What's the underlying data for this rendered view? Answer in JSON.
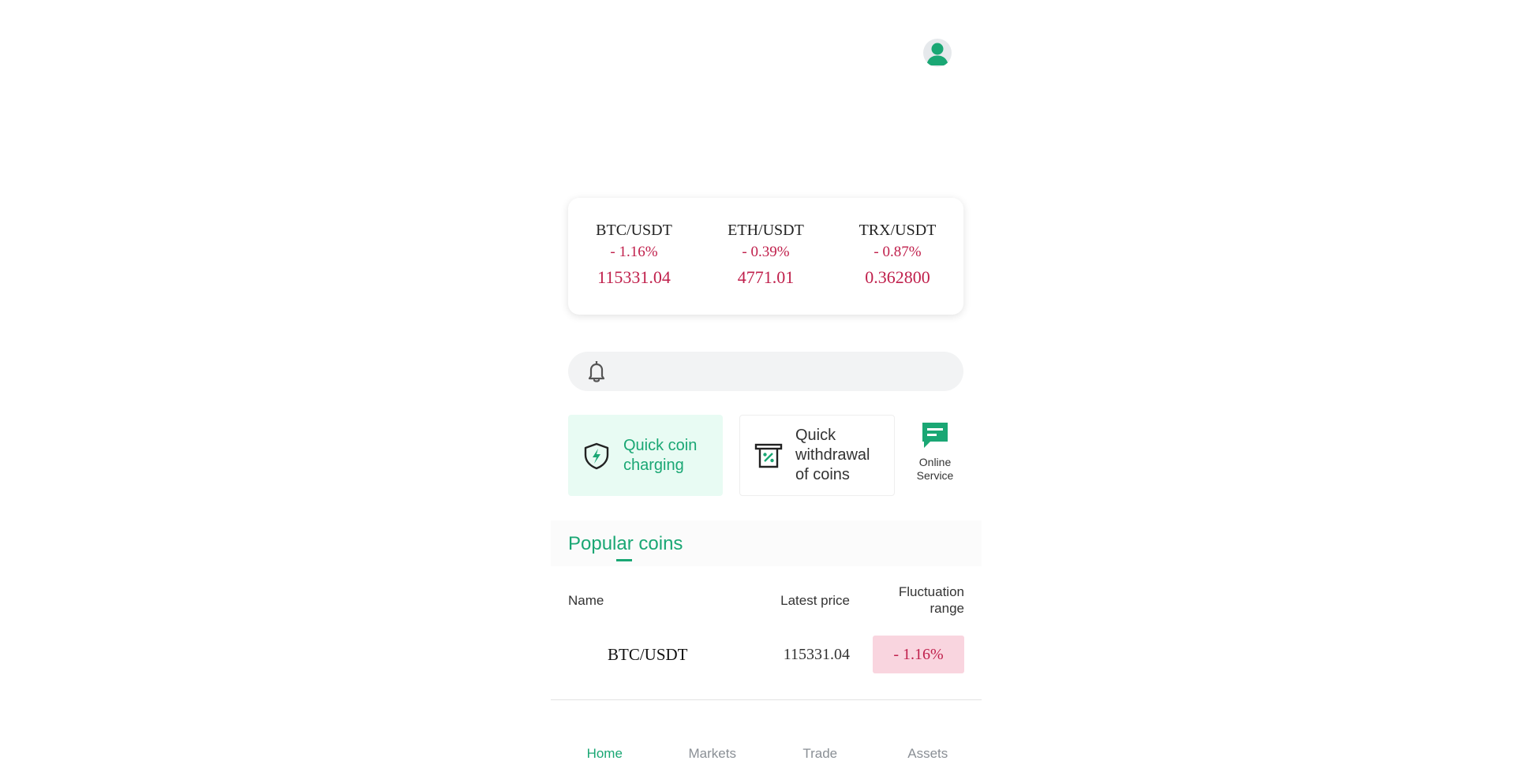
{
  "header": {
    "avatar_icon": "user-avatar-icon"
  },
  "tickers": [
    {
      "pair": "BTC/USDT",
      "change": "- 1.16%",
      "price": "115331.04"
    },
    {
      "pair": "ETH/USDT",
      "change": "- 0.39%",
      "price": "4771.01"
    },
    {
      "pair": "TRX/USDT",
      "change": "- 0.87%",
      "price": "0.362800"
    }
  ],
  "notice": {
    "icon": "bell-icon",
    "text": ""
  },
  "quick_actions": {
    "charge_label": "Quick coin charging",
    "withdraw_label": "Quick withdrawal of coins",
    "online_label": "Online Service"
  },
  "popular": {
    "tab_label": "Popular coins",
    "columns": {
      "name": "Name",
      "price": "Latest price",
      "range": "Fluctuation range"
    },
    "rows": [
      {
        "name": "BTC/USDT",
        "price": "115331.04",
        "change": "- 1.16%"
      }
    ]
  },
  "nav": {
    "items": [
      {
        "label": "Home"
      },
      {
        "label": "Markets"
      },
      {
        "label": "Trade"
      },
      {
        "label": "Assets"
      }
    ],
    "active": "Home"
  },
  "colors": {
    "accent": "#1aa774",
    "negative": "#c0204c",
    "negative_bg": "#f9d5df"
  }
}
